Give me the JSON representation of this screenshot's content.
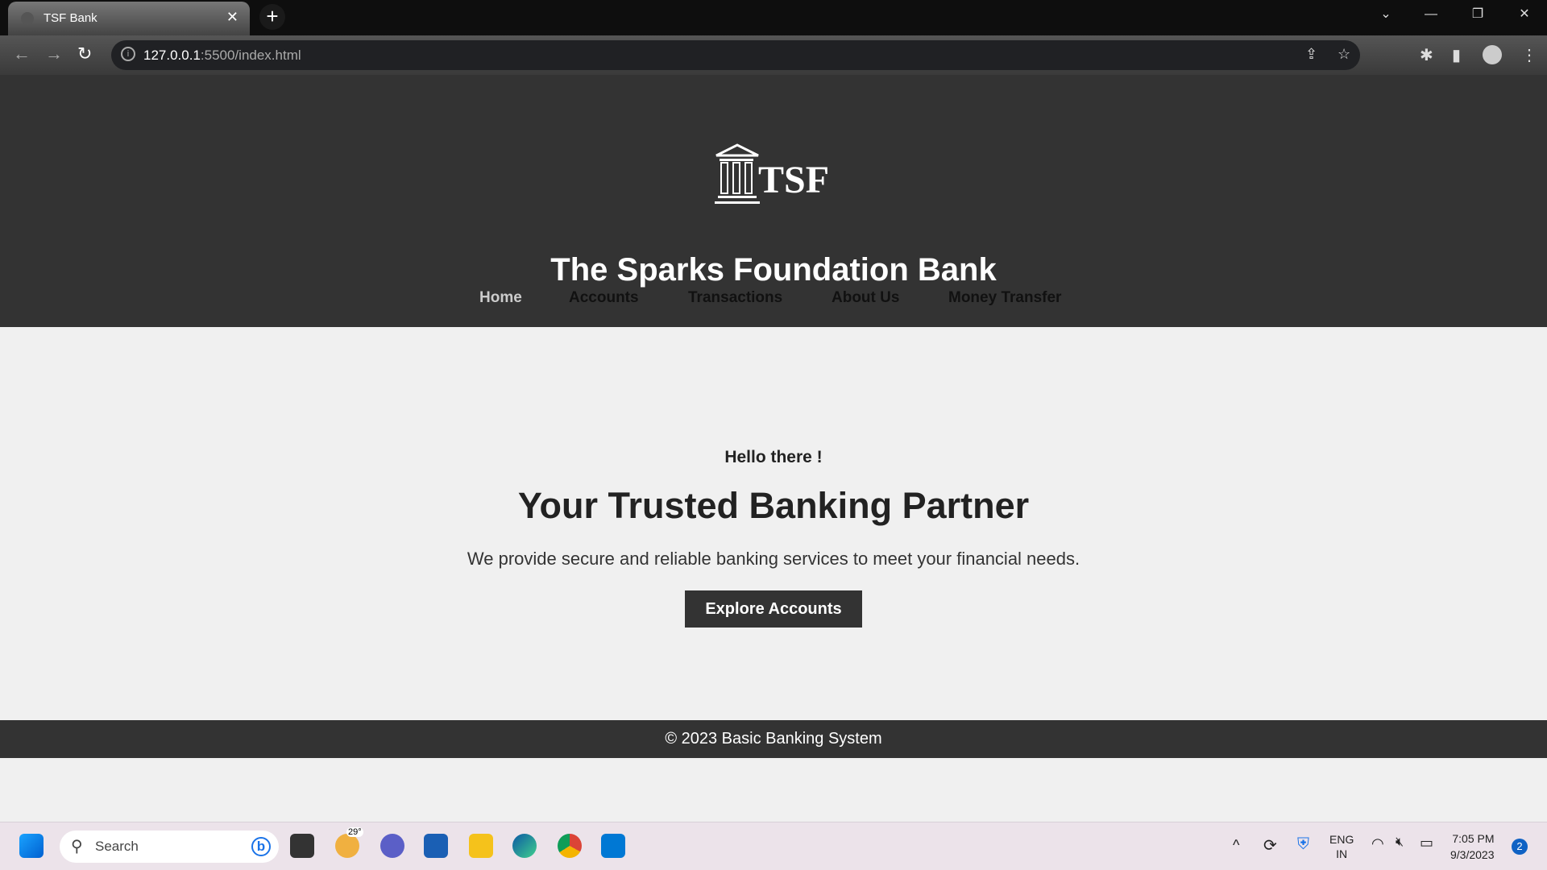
{
  "browser": {
    "tab_title": "TSF Bank",
    "url_host": "127.0.0.1",
    "url_rest": ":5500/index.html"
  },
  "header": {
    "logo_text": "TSF",
    "title": "The Sparks Foundation Bank",
    "nav": [
      "Home",
      "Accounts",
      "Transactions",
      "About Us",
      "Money Transfer"
    ]
  },
  "hero": {
    "greeting": "Hello there !",
    "headline": "Your Trusted Banking Partner",
    "description": "We provide secure and reliable banking services to meet your financial needs.",
    "cta": "Explore Accounts"
  },
  "footer": {
    "text": "© 2023 Basic Banking System"
  },
  "taskbar": {
    "search_placeholder": "Search",
    "weather": "29°",
    "lang1": "ENG",
    "lang2": "IN",
    "time": "7:05 PM",
    "date": "9/3/2023",
    "notifications": "2"
  },
  "colors": {
    "header_bg": "#333333",
    "page_bg": "#f0f0f0",
    "nav_active": "#cccccc"
  }
}
